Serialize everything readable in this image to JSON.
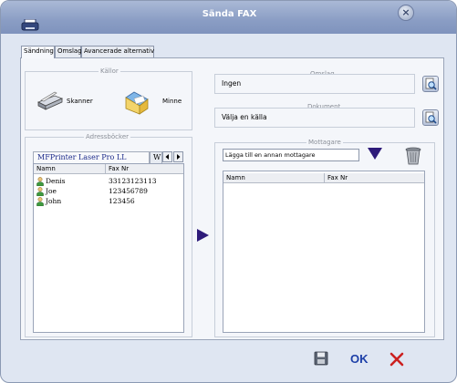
{
  "window": {
    "title": "Sända FAX",
    "close_symbol": "×"
  },
  "tabs": [
    {
      "label": "Sändning",
      "active": true
    },
    {
      "label": "Omslag",
      "active": false
    },
    {
      "label": "Avancerade alternativ",
      "active": false
    }
  ],
  "sources": {
    "group_label": "Källor",
    "scanner_label": "Skanner",
    "memory_label": "Minne"
  },
  "cover": {
    "group_label": "Omslag",
    "value": "Ingen"
  },
  "document": {
    "group_label": "Dokument",
    "value": "Välja en källa"
  },
  "address_books": {
    "group_label": "Adressböcker",
    "book_tab": "MFPrinter Laser Pro LL",
    "book_tab_next": "W",
    "columns": {
      "name": "Namn",
      "fax": "Fax Nr"
    },
    "entries": [
      {
        "name": "Denis",
        "fax": "33123123113"
      },
      {
        "name": "Joe",
        "fax": "123456789"
      },
      {
        "name": "John",
        "fax": "123456"
      }
    ]
  },
  "recipients": {
    "group_label": "Mottagare",
    "input_value": "Lägga till en annan mottagare",
    "columns": {
      "name": "Namn",
      "fax": "Fax Nr"
    },
    "entries": []
  },
  "footer": {
    "ok_label": "OK"
  },
  "colors": {
    "accent": "#2e1b7a",
    "cancel": "#cc2020",
    "ok": "#1d3fa8"
  }
}
